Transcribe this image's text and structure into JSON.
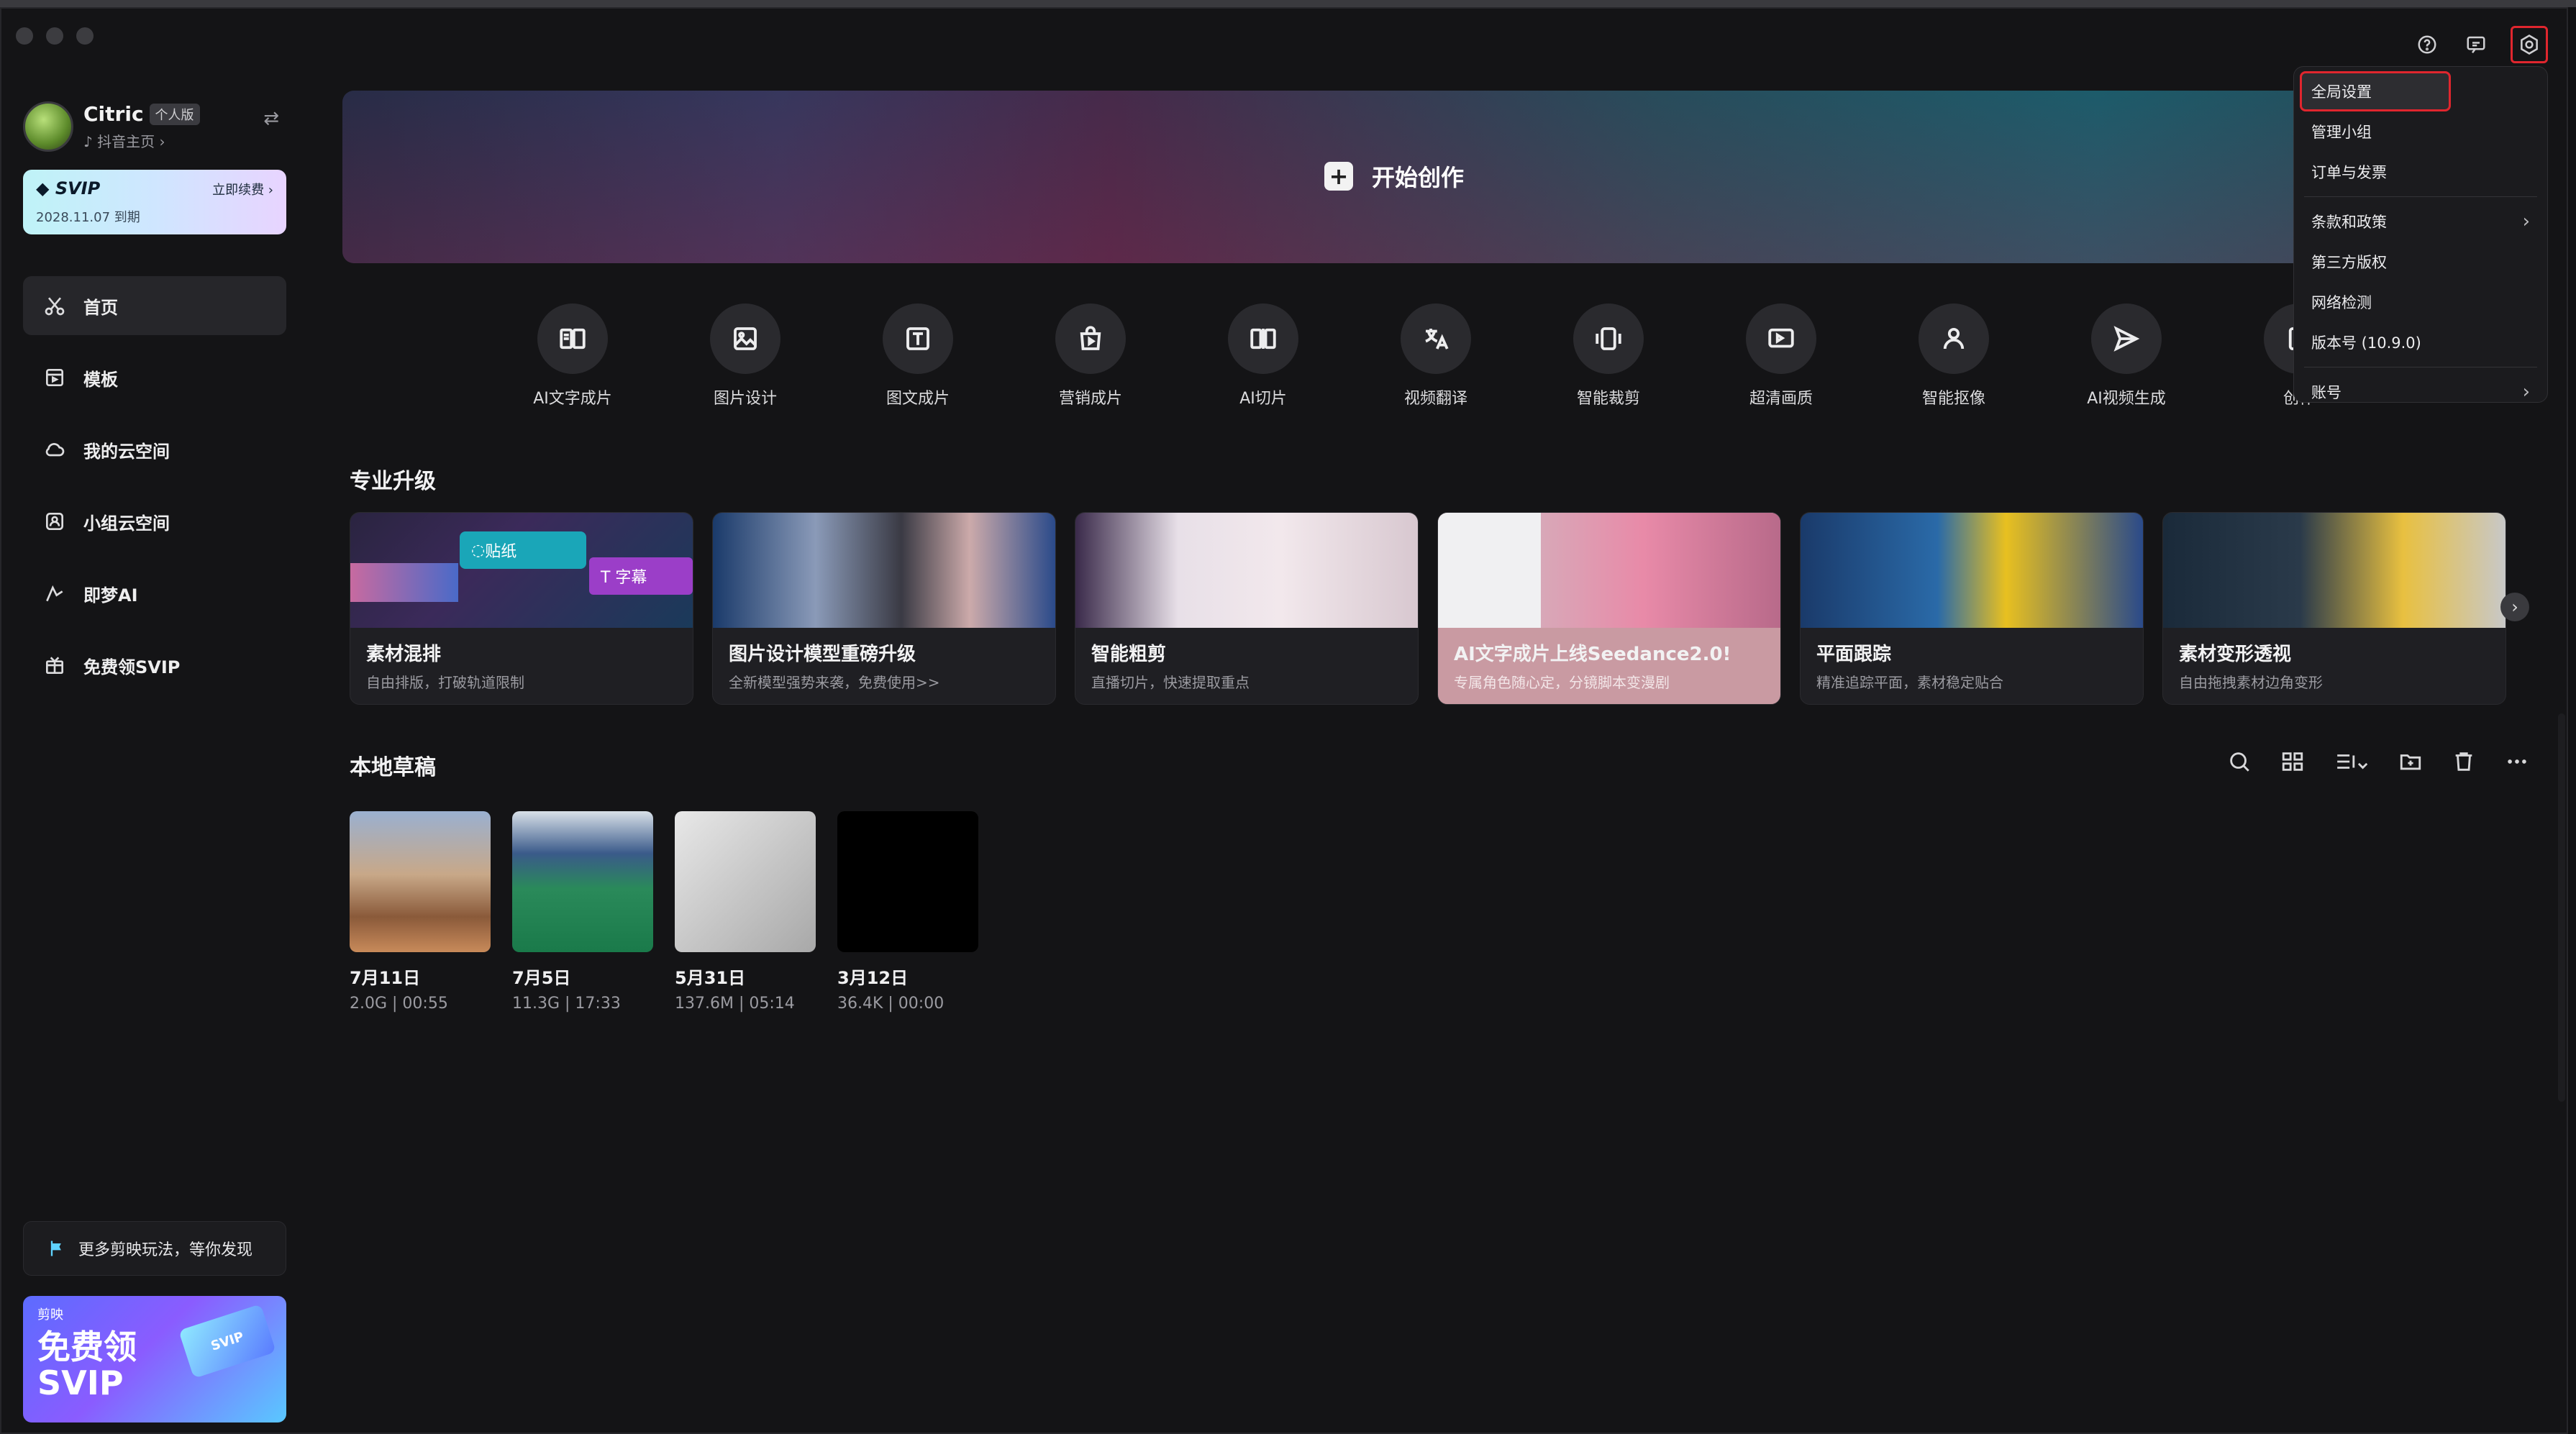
{
  "profile": {
    "name": "Citric",
    "tag": "个人版",
    "sub": "♪ 抖音主页 ›"
  },
  "svip": {
    "label": "SVIP",
    "renew": "立即续费 ›",
    "expiry": "2028.11.07 到期"
  },
  "nav": [
    {
      "label": "首页"
    },
    {
      "label": "模板"
    },
    {
      "label": "我的云空间"
    },
    {
      "label": "小组云空间"
    },
    {
      "label": "即梦AI"
    },
    {
      "label": "免费领SVIP"
    }
  ],
  "more_card": "更多剪映玩法，等你发现",
  "promo": {
    "brand": "剪映",
    "line1": "免费领",
    "line2": "SVIP",
    "ticket": "SVIP"
  },
  "hero": {
    "plus": "+",
    "label": "开始创作"
  },
  "tools": [
    {
      "label": "AI文字成片",
      "icon": "text-video-icon"
    },
    {
      "label": "图片设计",
      "icon": "image-design-icon"
    },
    {
      "label": "图文成片",
      "icon": "text-image-icon"
    },
    {
      "label": "营销成片",
      "icon": "shopping-bag-icon"
    },
    {
      "label": "AI切片",
      "icon": "slice-icon"
    },
    {
      "label": "视频翻译",
      "icon": "translate-icon"
    },
    {
      "label": "智能裁剪",
      "icon": "crop-icon"
    },
    {
      "label": "超清画质",
      "icon": "hd-icon"
    },
    {
      "label": "智能抠像",
      "icon": "cutout-icon"
    },
    {
      "label": "AI视频生成",
      "icon": "send-icon"
    },
    {
      "label": "创作",
      "icon": "create-icon"
    }
  ],
  "section_pro": "专业升级",
  "pro_cards": [
    {
      "title": "素材混排",
      "sub": "自由排版，打破轨道限制",
      "badge1": "贴纸",
      "badge2": "T 字幕"
    },
    {
      "title": "图片设计模型重磅升级",
      "sub": "全新模型强势来袭，免费使用>>"
    },
    {
      "title": "智能粗剪",
      "sub": "直播切片，快速提取重点"
    },
    {
      "title": "AI文字成片上线Seedance2.0!",
      "sub": "专属角色随心定，分镜脚本变漫剧"
    },
    {
      "title": "平面跟踪",
      "sub": "精准追踪平面，素材稳定贴合"
    },
    {
      "title": "素材变形透视",
      "sub": "自由拖拽素材边角变形"
    }
  ],
  "section_drafts": "本地草稿",
  "drafts": [
    {
      "date": "7月11日",
      "meta": "2.0G | 00:55"
    },
    {
      "date": "7月5日",
      "meta": "11.3G | 17:33"
    },
    {
      "date": "5月31日",
      "meta": "137.6M | 05:14"
    },
    {
      "date": "3月12日",
      "meta": "36.4K | 00:00"
    }
  ],
  "menu": [
    {
      "label": "全局设置"
    },
    {
      "label": "管理小组"
    },
    {
      "label": "订单与发票"
    },
    {
      "label": "条款和政策",
      "chevron": "›"
    },
    {
      "label": "第三方版权"
    },
    {
      "label": "网络检测"
    },
    {
      "label": "版本号 (10.9.0)"
    },
    {
      "label": "账号",
      "chevron": "›"
    }
  ],
  "colors": {
    "accent_red": "#e0262e",
    "bg": "#141416",
    "card": "#1f1f23"
  }
}
